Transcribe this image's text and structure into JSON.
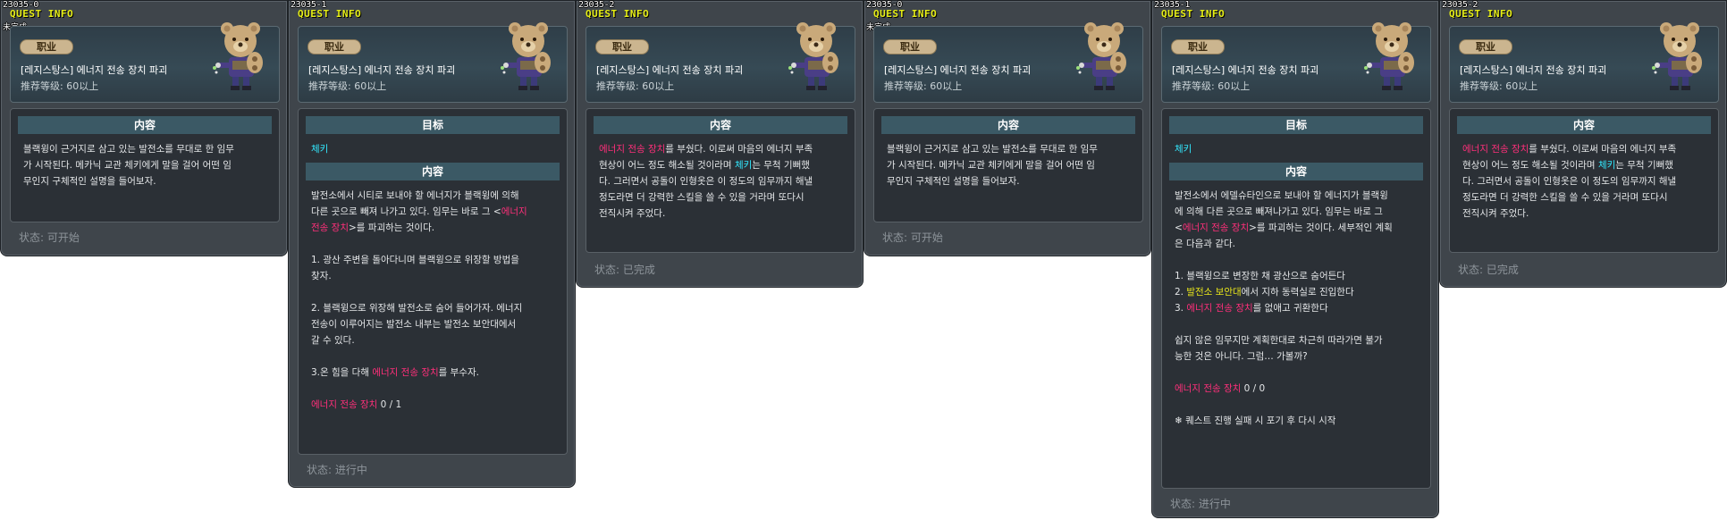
{
  "panels": [
    {
      "id": "23035-0",
      "title": "QUEST INFO",
      "tag": "未完成",
      "badge": "职业",
      "quest_name": "[레지스탕스] 에너지 전송 장치 파괴",
      "level_label": "推荐等级:",
      "level_value": "60以上",
      "section1": "内容",
      "content_lines": [
        "블랙윙이 근거지로 삼고 있는 발전소를 무대로 한 임무",
        "가 시작된다. 메카닉 교관 체키에게 말을 걸어 어떤 임",
        "무인지 구체적인 설명을 들어보자."
      ],
      "highlight_cyan": "체키",
      "status_label": "状态:",
      "status_value": "可开始"
    },
    {
      "id": "23035-1",
      "title": "QUEST INFO",
      "badge": "职业",
      "quest_name": "[레지스탕스] 에너지 전송 장치 파괴",
      "level_label": "推荐等级:",
      "level_value": "60以上",
      "section_target": "目标",
      "target_npc": "체키",
      "section1": "内容",
      "content": {
        "p1a": "발전소에서 시티로 보내야 할 에너지가 블랙윙에 의해",
        "p1b": "다른 곳으로 빼져 나가고 있다. 임무는 바로 그 <",
        "p1c_pink": "에너지",
        "p1d_pink": "전송 장치",
        "p1e": ">를 파괴하는 것이다.",
        "p2a": "1. 광산 주변을 돌아다니며 블랙윙으로 위장할 방법을",
        "p2b": "찾자.",
        "p3a": "2. 블랙윙으로 위장해 발전소로 숨어 들어가자. 에너지",
        "p3b": "전송이 이루어지는 발전소 내부는 발전소 보안대에서",
        "p3c": "갈 수 있다.",
        "p4a": "3.온 힘을 다해 ",
        "p4b_pink": "에너지 전송 장치",
        "p4c": "를 부수자.",
        "counter_pink": "에너지 전송 장치",
        "counter": " 0 / 1"
      },
      "status_label": "状态:",
      "status_value": "进行中"
    },
    {
      "id": "23035-2",
      "title": "QUEST INFO",
      "badge": "职业",
      "quest_name": "[레지스탕스] 에너지 전송 장치 파괴",
      "level_label": "推荐等级:",
      "level_value": "60以上",
      "section1": "内容",
      "content": {
        "l1_pink": "에너지 전송 장치",
        "l1": "를 부쉈다. 이로써 마음의 에너지 부족",
        "l2a": "현상이 어느 정도 해소될 것이라며 ",
        "l2_cyan": "체키",
        "l2b": "는 무척 기뻐했",
        "l3": "다. 그러면서 공돌이 인형옷은 이 정도의 임무까지 해낼",
        "l4": "정도라면 더 강력한 스킬을 쓸 수 있을 거라며 또다시",
        "l5": "전직시켜 주었다."
      },
      "status_label": "状态:",
      "status_value": "已完成"
    },
    {
      "id": "23035-0",
      "title": "QUEST INFO",
      "tag": "未完成",
      "badge": "职业",
      "quest_name": "[레지스탕스] 에너지 전송 장치 파괴",
      "level_label": "推荐等级:",
      "level_value": "60以上",
      "section1": "内容",
      "content_lines": [
        "블랙윙이 근거지로 삼고 있는 발전소를 무대로 한 임무",
        "가 시작된다. 메카닉 교관 체키에게 말을 걸어 어떤 임",
        "무인지 구체적인 설명을 들어보자."
      ],
      "status_label": "状态:",
      "status_value": "可开始"
    },
    {
      "id": "23035-1",
      "title": "QUEST INFO",
      "badge": "职业",
      "quest_name": "[레지스탕스] 에너지 전송 장치 파괴",
      "level_label": "推荐等级:",
      "level_value": "60以上",
      "section_target": "目标",
      "target_npc": "체키",
      "section1": "内容",
      "content": {
        "p1a": "발전소에서 에델슈타인으로 보내야 할 에너지가 블랙윙",
        "p1b": "에 의해 다른 곳으로 빼져나가고 있다. 임무는 바로 그",
        "p1c": "<",
        "p1c_pink": "에너지 전송 장치",
        "p1d": ">를 파괴하는 것이다. 세부적인 계획",
        "p1e": "은 다음과 같다.",
        "s1": "1. 블랙윙으로 변장한 채 광산으로 숨어든다",
        "s2a": "2. ",
        "s2_yellow": "발전소 보안대",
        "s2b": "에서 지하 동력실로 진입한다",
        "s3a": "3. ",
        "s3_pink": "에너지 전송 장치",
        "s3b": "를 없애고 귀환한다",
        "p3a": "쉽지 않은 임무지만 계획한대로 차근히 따라가면 불가",
        "p3b": "능한 것은 아니다. 그럼… 가볼까?",
        "counter_pink": "에너지 전송 장치",
        "counter": " 0 / 0",
        "note": "❄ 퀘스트 진행 실패 시 포기 후 다시 시작"
      },
      "status_label": "状态:",
      "status_value": "进行中"
    },
    {
      "id": "23035-2",
      "title": "QUEST INFO",
      "badge": "职业",
      "quest_name": "[레지스탕스] 에너지 전송 장치 파괴",
      "level_label": "推荐等级:",
      "level_value": "60以上",
      "section1": "内容",
      "content": {
        "l1_pink": "에너지 전송 장치",
        "l1": "를 부쉈다. 이로써 마음의 에너지 부족",
        "l2a": "현상이 어느 정도 해소될 것이라며 ",
        "l2_cyan": "체키",
        "l2b": "는 무척 기뻐했",
        "l3": "다. 그러면서 공돌이 인형옷은 이 정도의 임무까지 해낼",
        "l4": "정도라면 더 강력한 스킬을 쓸 수 있을 거라며 또다시",
        "l5": "전직시켜 주었다."
      },
      "status_label": "状态:",
      "status_value": "已完成"
    }
  ],
  "colors": {
    "pink": "#ff2f7a",
    "cyan": "#33e9ff",
    "yellow": "#e8e51a",
    "title_yellow": "#e6ee16"
  },
  "icons": [
    "teddy-bear-npc-icon"
  ]
}
